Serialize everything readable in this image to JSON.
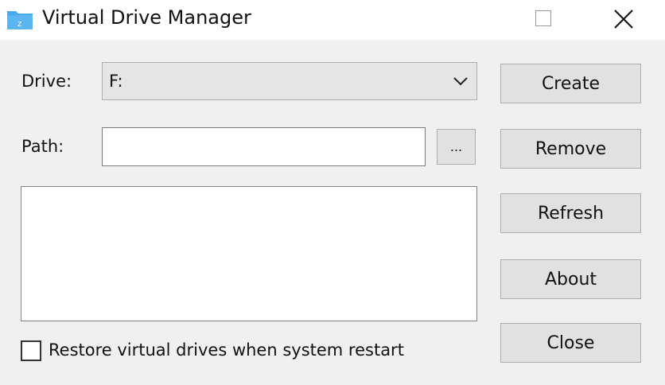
{
  "window": {
    "title": "Virtual Drive Manager"
  },
  "drive": {
    "label": "Drive:",
    "value": "F:"
  },
  "path": {
    "label": "Path:",
    "value": "",
    "browse_label": "..."
  },
  "buttons": {
    "create": "Create",
    "remove": "Remove",
    "refresh": "Refresh",
    "about": "About",
    "close": "Close"
  },
  "restore": {
    "label": "Restore virtual drives when system restart",
    "checked": false
  },
  "colors": {
    "folder": "#4aa8e8"
  }
}
